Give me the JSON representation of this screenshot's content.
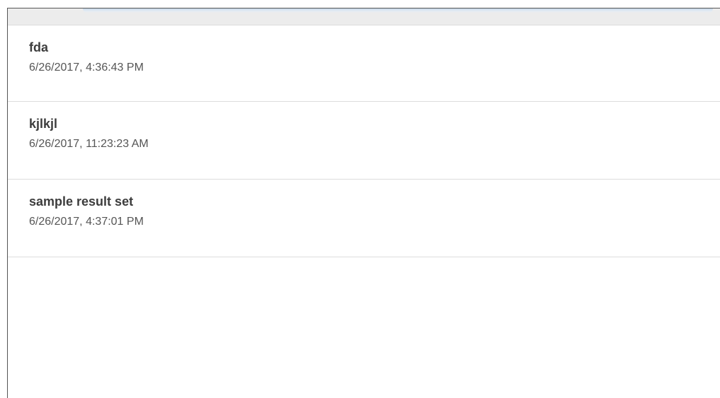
{
  "result_sets": [
    {
      "name": "fda",
      "timestamp": "6/26/2017, 4:36:43 PM"
    },
    {
      "name": "kjlkjl",
      "timestamp": "6/26/2017, 11:23:23 AM"
    },
    {
      "name": "sample result set",
      "timestamp": "6/26/2017, 4:37:01 PM"
    }
  ],
  "colors": {
    "border": "#555555",
    "divider": "#dddddd",
    "title_text": "#3d3d3d",
    "date_text": "#555555",
    "top_bar": "#ececec"
  }
}
